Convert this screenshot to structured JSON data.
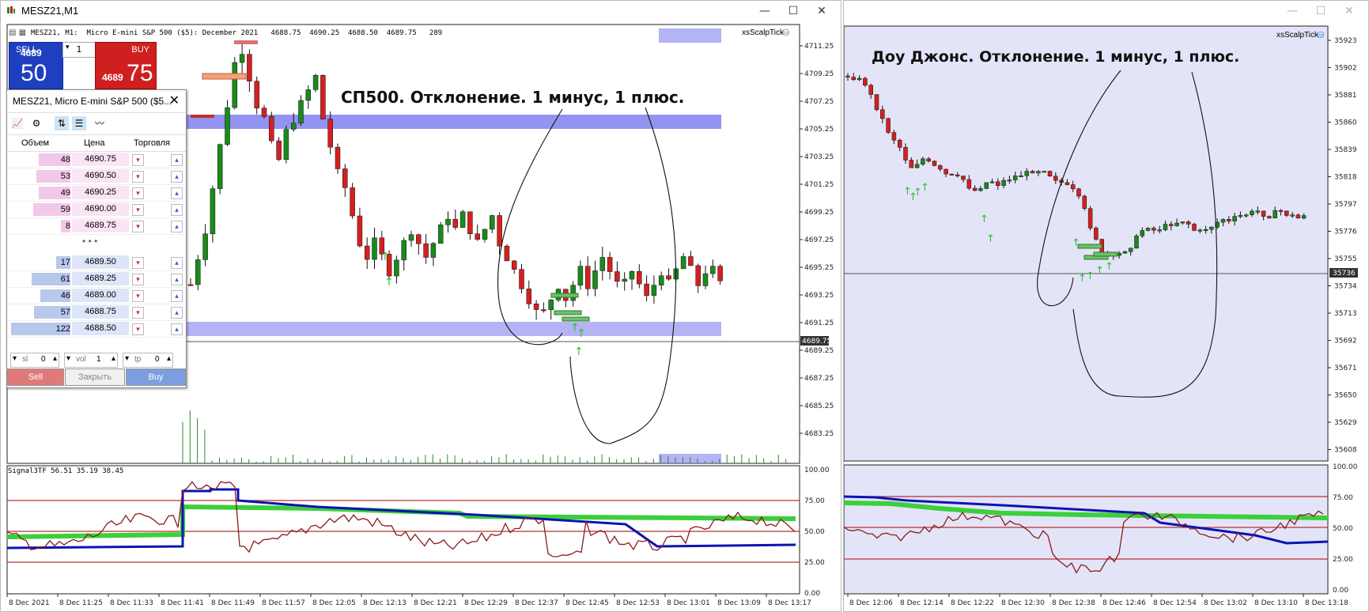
{
  "left_window": {
    "title": "MESZ21,M1",
    "chart_header": "MESZ21, M1:  Micro E-mini S&P 500 ($5): December 2021   4688.75  4690.25  4688.50  4689.75   289",
    "indicator_label": "xsScalpTick",
    "annotation": "СП500. Отклонение. 1 минус, 1 плюс.",
    "price_axis": [
      "4711.25",
      "4709.25",
      "4707.25",
      "4705.25",
      "4703.25",
      "4701.25",
      "4699.25",
      "4697.25",
      "4695.25",
      "4693.25",
      "4691.25",
      "4689.25",
      "4687.25",
      "4685.25",
      "4683.25"
    ],
    "current_price": "4689.75",
    "subwindow_label": "Signal3TF 56.51 35.19 38.45",
    "sub_axis": [
      "100.00",
      "75.00",
      "50.00",
      "25.00",
      "0.00"
    ],
    "time_axis": [
      "8 Dec 2021",
      "8 Dec 11:25",
      "8 Dec 11:33",
      "8 Dec 11:41",
      "8 Dec 11:49",
      "8 Dec 11:57",
      "8 Dec 12:05",
      "8 Dec 12:13",
      "8 Dec 12:21",
      "8 Dec 12:29",
      "8 Dec 12:37",
      "8 Dec 12:45",
      "8 Dec 12:53",
      "8 Dec 13:01",
      "8 Dec 13:09",
      "8 Dec 13:17"
    ],
    "trade_panel": {
      "sell_label": "SELL",
      "buy_label": "BUY",
      "qty": "1",
      "sell_small": "4689",
      "sell_big": "50",
      "buy_small": "4689",
      "buy_big": "75"
    }
  },
  "dom": {
    "title": "MESZ21, Micro E-mini S&P 500 ($5...",
    "headers": {
      "volume": "Объем",
      "price": "Цена",
      "trade": "Торговля"
    },
    "asks": [
      {
        "vol": "48",
        "price": "4690.75"
      },
      {
        "vol": "53",
        "price": "4690.50"
      },
      {
        "vol": "49",
        "price": "4690.25"
      },
      {
        "vol": "59",
        "price": "4690.00"
      },
      {
        "vol": "8",
        "price": "4689.75"
      }
    ],
    "bids": [
      {
        "vol": "17",
        "price": "4689.50"
      },
      {
        "vol": "61",
        "price": "4689.25"
      },
      {
        "vol": "46",
        "price": "4689.00"
      },
      {
        "vol": "57",
        "price": "4688.75"
      },
      {
        "vol": "122",
        "price": "4688.50"
      }
    ],
    "dots": "• • •",
    "sl_label": "sl",
    "sl_value": "0",
    "vol_label": "vol",
    "vol_value": "1",
    "tp_label": "tp",
    "tp_value": "0",
    "sell_button": "Sell",
    "close_button": "Закрыть",
    "buy_button": "Buy"
  },
  "right_window": {
    "indicator_label": "xsScalpTick",
    "annotation": "Доу Джонс. Отклонение. 1 минус, 1 плюс.",
    "price_axis": [
      "35923",
      "35902",
      "35881",
      "35860",
      "35839",
      "35818",
      "35797",
      "35776",
      "35755",
      "35734",
      "35713",
      "35692",
      "35671",
      "35650",
      "35629",
      "35608"
    ],
    "current_price": "35736",
    "sub_axis": [
      "100.00",
      "75.00",
      "50.00",
      "25.00",
      "0.00"
    ],
    "time_axis": [
      "8 Dec 12:06",
      "8 Dec 12:14",
      "8 Dec 12:22",
      "8 Dec 12:30",
      "8 Dec 12:38",
      "8 Dec 12:46",
      "8 Dec 12:54",
      "8 Dec 13:02",
      "8 Dec 13:10",
      "8 Dec 13:18"
    ]
  },
  "colors": {
    "bull": "#1a8a1a",
    "bear": "#d42020",
    "zone": "#8080ee",
    "bg_right": "#e4e4f8",
    "blue_line": "#0a14b4",
    "green_line": "#3ccf3c",
    "red_line": "#8b1a1a"
  }
}
